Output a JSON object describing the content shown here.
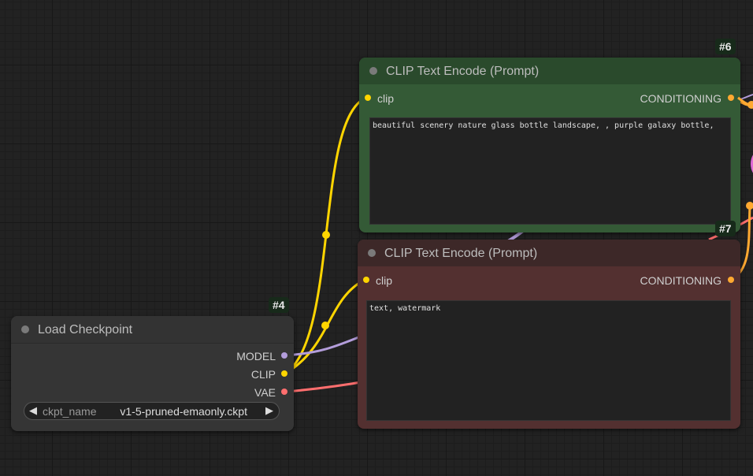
{
  "colors": {
    "canvas_bg": "#222222",
    "clip_wire": "#ffd500",
    "model_wire": "#b39ddb",
    "vae_wire": "#ff6e6e",
    "conditioning_wire": "#ffa931",
    "positive_node_title": "#2a4a2c",
    "positive_node_body": "#345a36",
    "negative_node_title": "#3d2828",
    "negative_node_body": "#533030",
    "default_node_title": "#333333",
    "default_node_body": "#353535"
  },
  "nodes": {
    "load_checkpoint": {
      "id": "#4",
      "title": "Load Checkpoint",
      "outputs": {
        "model": "MODEL",
        "clip": "CLIP",
        "vae": "VAE"
      },
      "widget": {
        "name": "ckpt_name",
        "value": "v1-5-pruned-emaonly.ckpt",
        "left_arrow": "◀",
        "right_arrow": "▶"
      }
    },
    "clip_positive": {
      "id": "#6",
      "title": "CLIP Text Encode (Prompt)",
      "input": "clip",
      "output": "CONDITIONING",
      "text": "beautiful scenery nature glass bottle landscape, , purple galaxy bottle,"
    },
    "clip_negative": {
      "id": "#7",
      "title": "CLIP Text Encode (Prompt)",
      "input": "clip",
      "output": "CONDITIONING",
      "text": "text, watermark"
    }
  }
}
